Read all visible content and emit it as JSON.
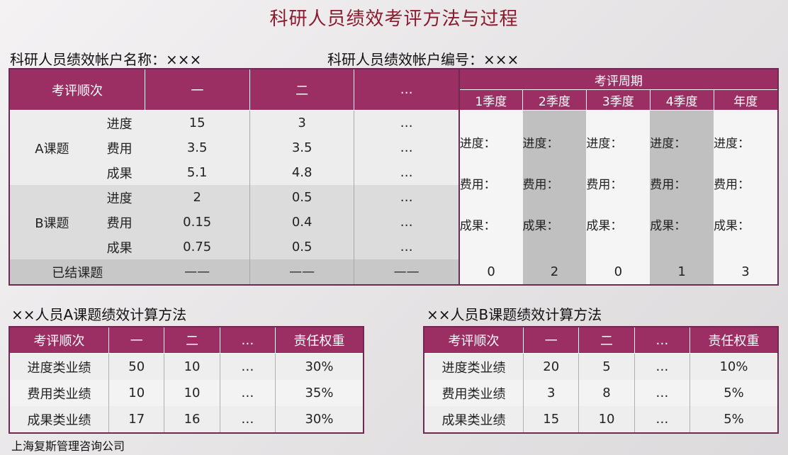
{
  "title": "科研人员绩效考评方法与过程",
  "account": {
    "name_label": "科研人员绩效帐户名称：×××",
    "id_label": "科研人员绩效帐户编号：×××"
  },
  "main": {
    "header_order": "考评顺次",
    "col1": "一",
    "col2": "二",
    "col3": "…",
    "cycle_header": "考评周期",
    "cycles": [
      "1季度",
      "2季度",
      "3季度",
      "4季度",
      "年度"
    ],
    "groupA": "A课题",
    "groupB": "B课题",
    "metrics": [
      "进度",
      "费用",
      "成果"
    ],
    "rowsA": [
      [
        "15",
        "3",
        "…"
      ],
      [
        "3.5",
        "3.5",
        "…"
      ],
      [
        "5.1",
        "4.8",
        "…"
      ]
    ],
    "rowsB": [
      [
        "2",
        "0.5",
        "…"
      ],
      [
        "0.15",
        "0.4",
        "…"
      ],
      [
        "0.75",
        "0.5",
        "…"
      ]
    ],
    "period_labels": [
      "进度：",
      "费用：",
      "成果："
    ],
    "closed_label": "已结课题",
    "closed_vals": [
      "——",
      "——",
      "——"
    ],
    "closed_counts": [
      "0",
      "2",
      "0",
      "1",
      "3"
    ]
  },
  "subA": {
    "label": "××人员A课题绩效计算方法",
    "headers": [
      "考评顺次",
      "一",
      "二",
      "…",
      "责任权重"
    ],
    "rows": [
      [
        "进度类业绩",
        "50",
        "10",
        "…",
        "30%"
      ],
      [
        "费用类业绩",
        "10",
        "10",
        "…",
        "35%"
      ],
      [
        "成果类业绩",
        "17",
        "16",
        "…",
        "30%"
      ]
    ]
  },
  "subB": {
    "label": "××人员B课题绩效计算方法",
    "headers": [
      "考评顺次",
      "一",
      "二",
      "…",
      "责任权重"
    ],
    "rows": [
      [
        "进度类业绩",
        "20",
        "5",
        "…",
        "10%"
      ],
      [
        "费用类业绩",
        "3",
        "8",
        "…",
        "5%"
      ],
      [
        "成果类业绩",
        "15",
        "10",
        "…",
        "5%"
      ]
    ]
  },
  "footer": "上海复斯管理咨询公司"
}
